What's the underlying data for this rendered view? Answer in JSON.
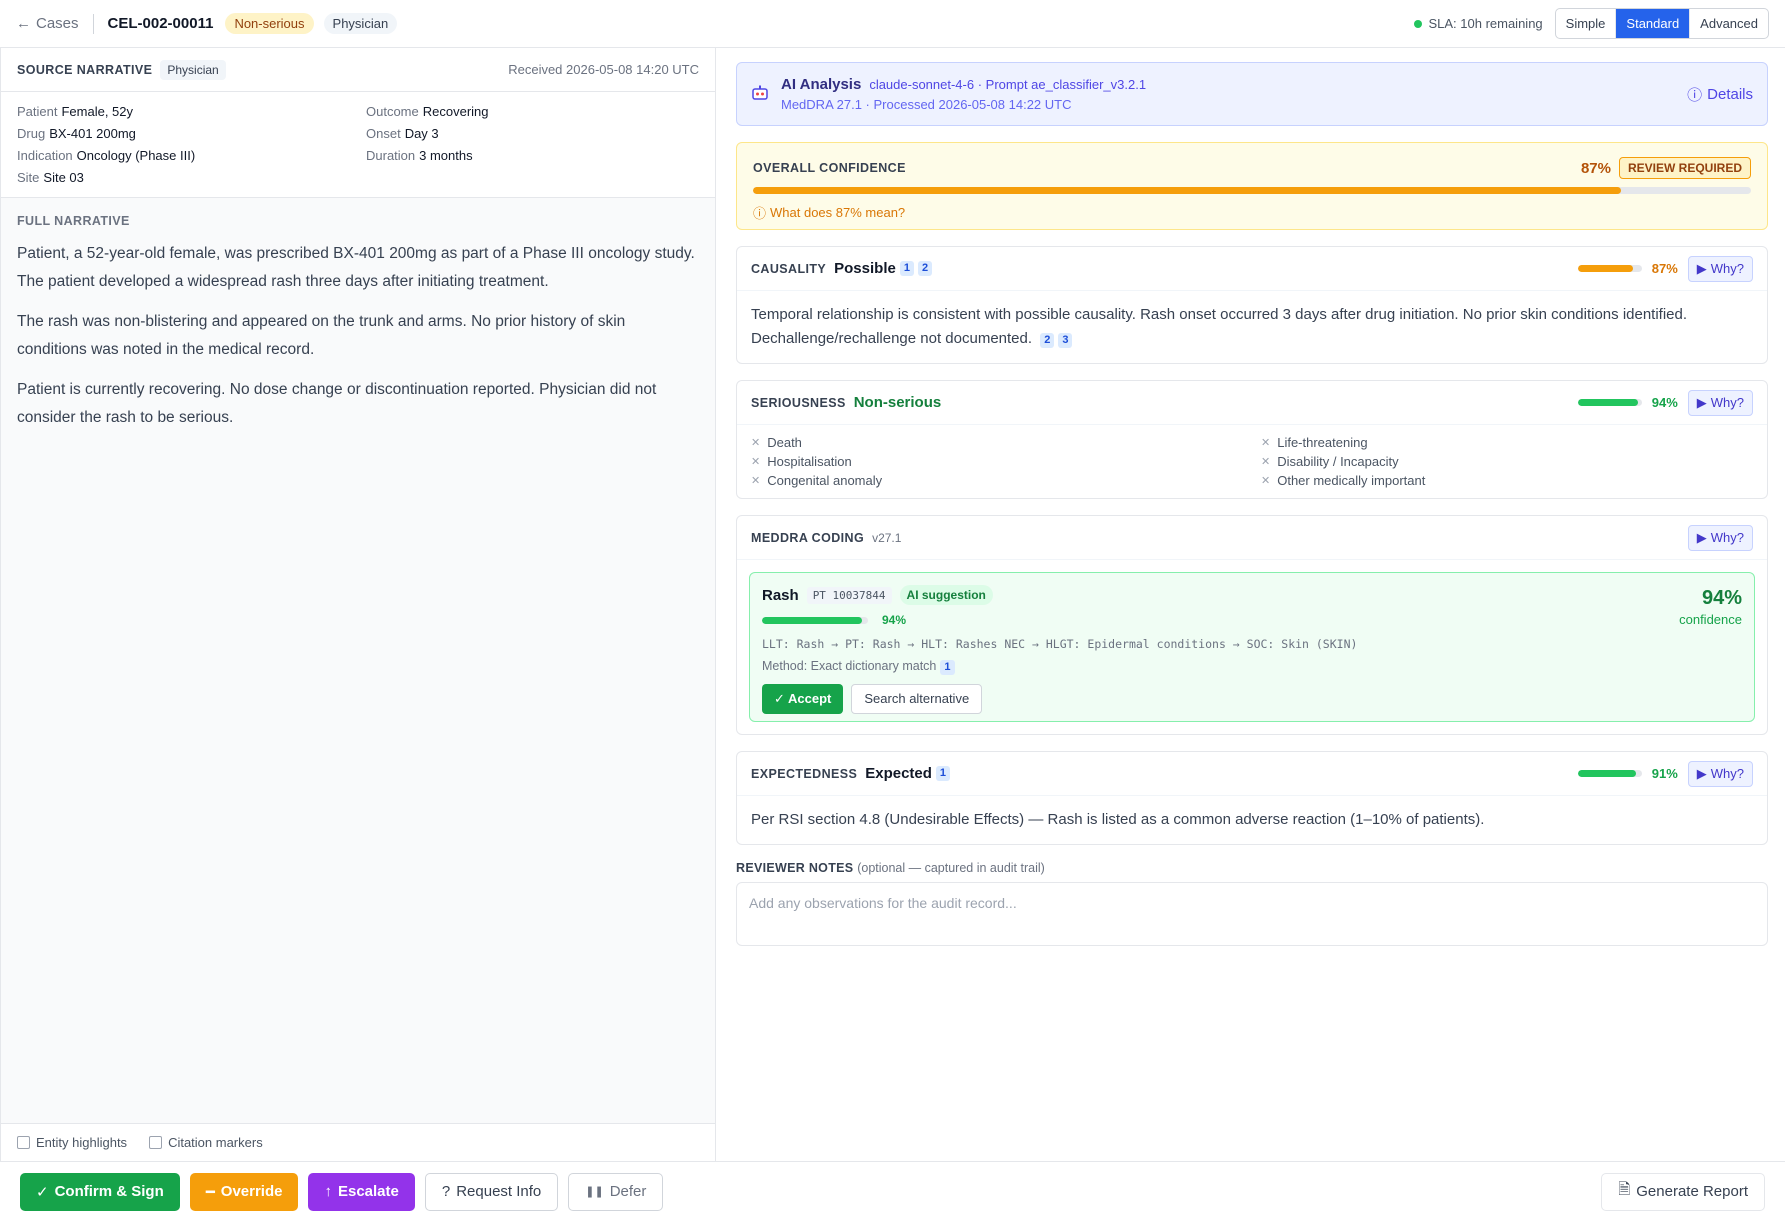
{
  "header": {
    "back_label": "Cases",
    "case_id": "CEL-002-00011",
    "seriousness_pill": "Non-serious",
    "reporter_pill": "Physician",
    "sla": "SLA: 10h remaining",
    "modes": [
      "Simple",
      "Standard",
      "Advanced"
    ],
    "active_mode": "Standard"
  },
  "source": {
    "title": "SOURCE NARRATIVE",
    "tag": "Physician",
    "received": "Received 2026-05-08 14:20 UTC",
    "fields": [
      {
        "k": "Patient",
        "v": "Female, 52y"
      },
      {
        "k": "Outcome",
        "v": "Recovering"
      },
      {
        "k": "Drug",
        "v": "BX-401 200mg"
      },
      {
        "k": "Onset",
        "v": "Day 3"
      },
      {
        "k": "Indication",
        "v": "Oncology (Phase III)"
      },
      {
        "k": "Duration",
        "v": "3 months"
      },
      {
        "k": "Site",
        "v": "Site 03"
      }
    ],
    "narrative_label": "FULL NARRATIVE",
    "paragraphs": [
      "Patient, a 52-year-old female, was prescribed BX-401 200mg as part of a Phase III oncology study. The patient developed a widespread rash three days after initiating treatment.",
      "The rash was non-blistering and appeared on the trunk and arms. No prior history of skin conditions was noted in the medical record.",
      "Patient is currently recovering. No dose change or discontinuation reported. Physician did not consider the rash to be serious."
    ],
    "toggles": [
      "Entity highlights",
      "Citation markers"
    ]
  },
  "ai": {
    "title": "AI Analysis",
    "model": "claude-sonnet-4-6 · Prompt ae_classifier_v3.2.1",
    "sub": "MedDRA 27.1 · Processed 2026-05-08 14:22 UTC",
    "details": "Details"
  },
  "confidence": {
    "label": "OVERALL CONFIDENCE",
    "pct": "87%",
    "value": 0.87,
    "badge": "REVIEW REQUIRED",
    "help": "What does 87% mean?",
    "color": "#f59e0b"
  },
  "causality": {
    "label": "CAUSALITY",
    "value": "Possible",
    "cites": [
      "1",
      "2"
    ],
    "pct": "87%",
    "level": 0.87,
    "color": "#f59e0b",
    "why": "Why?",
    "body": "Temporal relationship is consistent with possible causality. Rash onset occurred 3 days after drug initiation. No prior skin conditions identified. Dechallenge/rechallenge not documented.",
    "body_cites": [
      "2",
      "3"
    ]
  },
  "seriousness": {
    "label": "SERIOUSNESS",
    "value": "Non-serious",
    "pct": "94%",
    "level": 0.94,
    "color": "#22c55e",
    "why": "Why?",
    "criteria": [
      "Death",
      "Life-threatening",
      "Hospitalisation",
      "Disability / Incapacity",
      "Congenital anomaly",
      "Other medically important"
    ]
  },
  "meddra": {
    "label": "MEDDRA CODING",
    "version": "v27.1",
    "why": "Why?",
    "term": "Rash",
    "pt": "PT 10037844",
    "suggestion": "AI suggestion",
    "pct": "94%",
    "level": 0.94,
    "big_pct": "94%",
    "big_label": "confidence",
    "path": "LLT: Rash → PT: Rash → HLT: Rashes NEC → HLGT: Epidermal conditions → SOC: Skin (SKIN)",
    "method": "Method: Exact dictionary match",
    "method_cite": "1",
    "accept": "Accept",
    "alt": "Search alternative"
  },
  "expectedness": {
    "label": "EXPECTEDNESS",
    "value": "Expected",
    "cite": "1",
    "pct": "91%",
    "level": 0.91,
    "color": "#22c55e",
    "why": "Why?",
    "body": "Per RSI section 4.8 (Undesirable Effects) — Rash is listed as a common adverse reaction (1–10% of patients)."
  },
  "notes": {
    "label": "REVIEWER NOTES",
    "optional": "(optional — captured in audit trail)",
    "placeholder": "Add any observations for the audit record..."
  },
  "actions": {
    "confirm": "Confirm & Sign",
    "override": "Override",
    "escalate": "Escalate",
    "request": "Request Info",
    "defer": "Defer",
    "report": "Generate Report"
  }
}
